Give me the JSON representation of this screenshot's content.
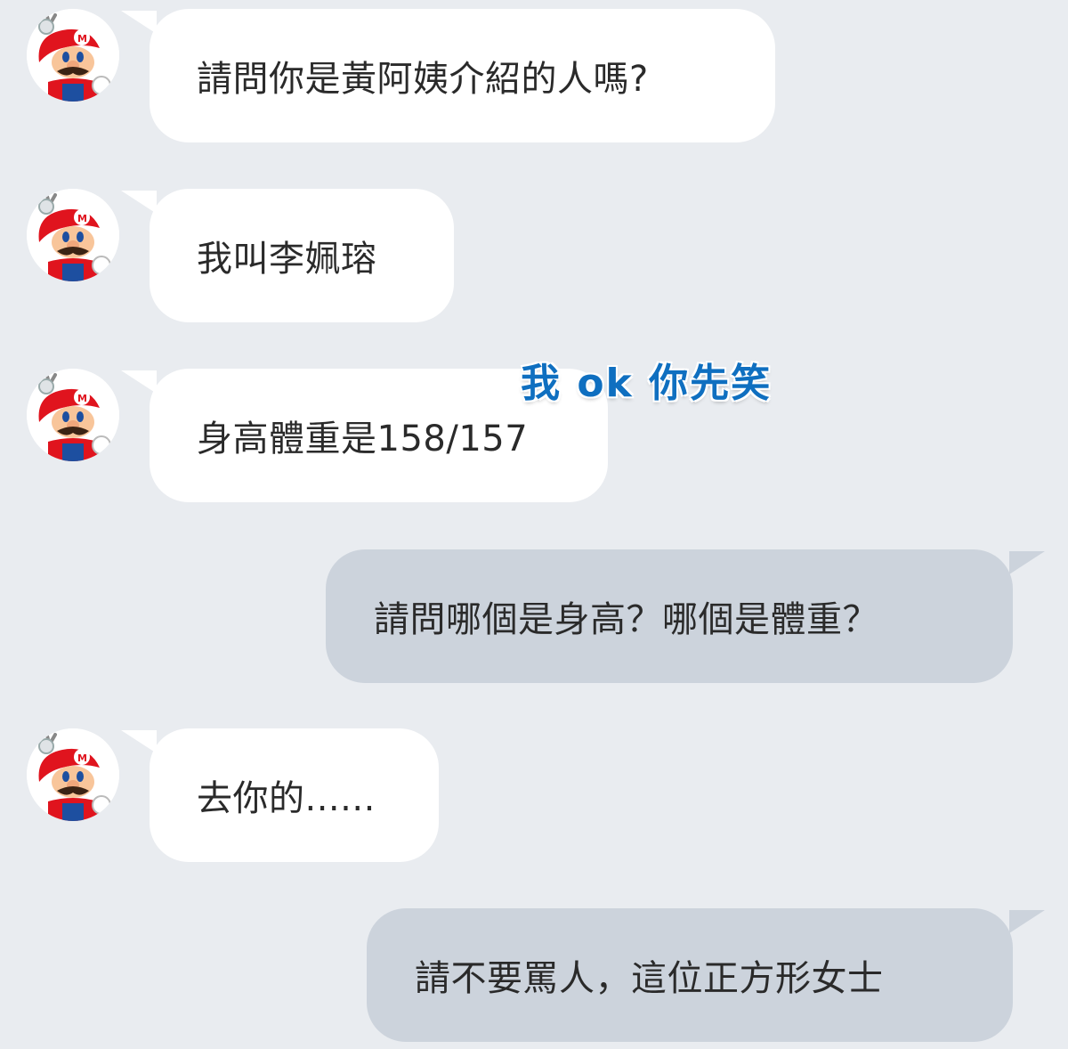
{
  "theme": {
    "background": "#e9ecf0",
    "incoming_bubble": "#ffffff",
    "outgoing_bubble": "#ccd3dc",
    "caption_color": "#0f6fc0"
  },
  "contact": {
    "avatar_icon": "mario-avatar-icon"
  },
  "overlay": {
    "caption": "我 ok 你先笑"
  },
  "messages": [
    {
      "direction": "incoming",
      "text": "請問你是黃阿姨介紹的人嗎?"
    },
    {
      "direction": "incoming",
      "text": "我叫李姵瑢"
    },
    {
      "direction": "incoming",
      "text": "身高體重是158/157"
    },
    {
      "direction": "outgoing",
      "text": "請問哪個是身高？哪個是體重？"
    },
    {
      "direction": "incoming",
      "text": "去你的......"
    },
    {
      "direction": "outgoing",
      "text": "請不要罵人，這位正方形女士"
    }
  ]
}
